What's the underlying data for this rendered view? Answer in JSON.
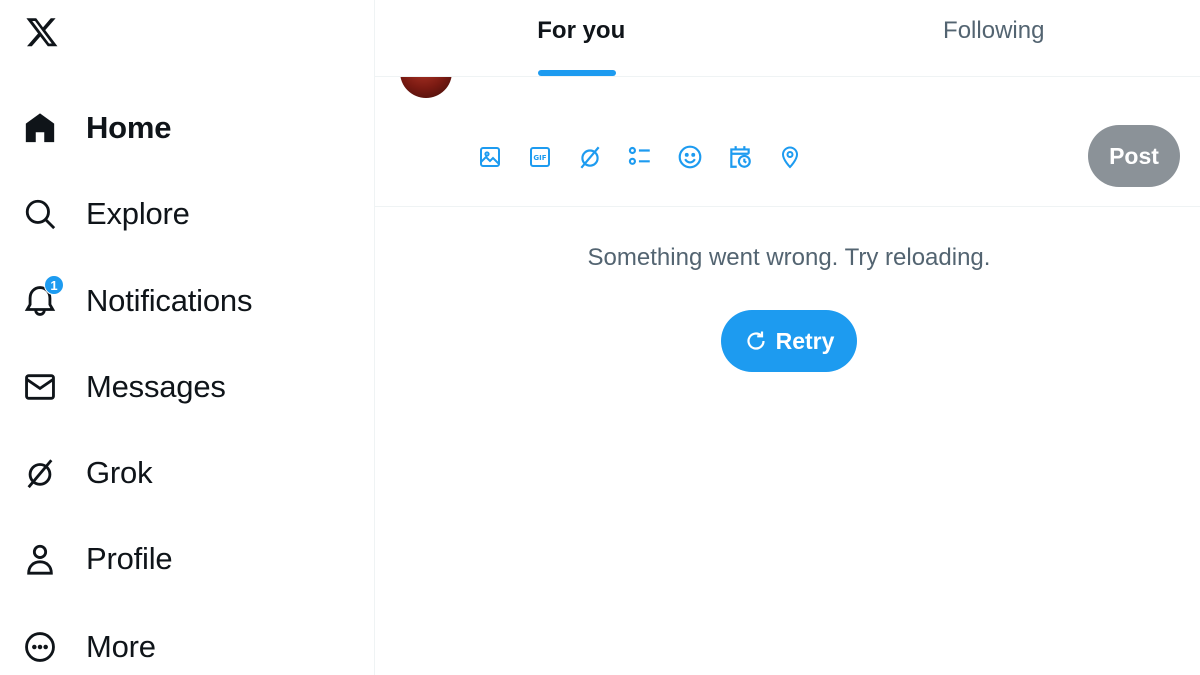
{
  "sidebar": {
    "logo_icon": "x-logo-icon",
    "items": [
      {
        "label": "Home",
        "icon": "home-icon",
        "active": true
      },
      {
        "label": "Explore",
        "icon": "search-icon"
      },
      {
        "label": "Notifications",
        "icon": "bell-icon",
        "badge": "1"
      },
      {
        "label": "Messages",
        "icon": "envelope-icon"
      },
      {
        "label": "Grok",
        "icon": "grok-icon"
      },
      {
        "label": "Profile",
        "icon": "person-icon"
      },
      {
        "label": "More",
        "icon": "more-circle-icon"
      }
    ]
  },
  "tabs": [
    {
      "label": "For you",
      "active": true
    },
    {
      "label": "Following",
      "active": false
    }
  ],
  "composer": {
    "tools": [
      "image-icon",
      "gif-icon",
      "grok-icon",
      "poll-icon",
      "emoji-icon",
      "schedule-icon",
      "location-icon"
    ],
    "post_label": "Post"
  },
  "feed": {
    "error_message": "Something went wrong. Try reloading.",
    "retry_label": "Retry"
  },
  "colors": {
    "accent": "#1d9bf0",
    "text": "#0f1419",
    "secondary_text": "#536471",
    "disabled_button": "#8b9298"
  }
}
